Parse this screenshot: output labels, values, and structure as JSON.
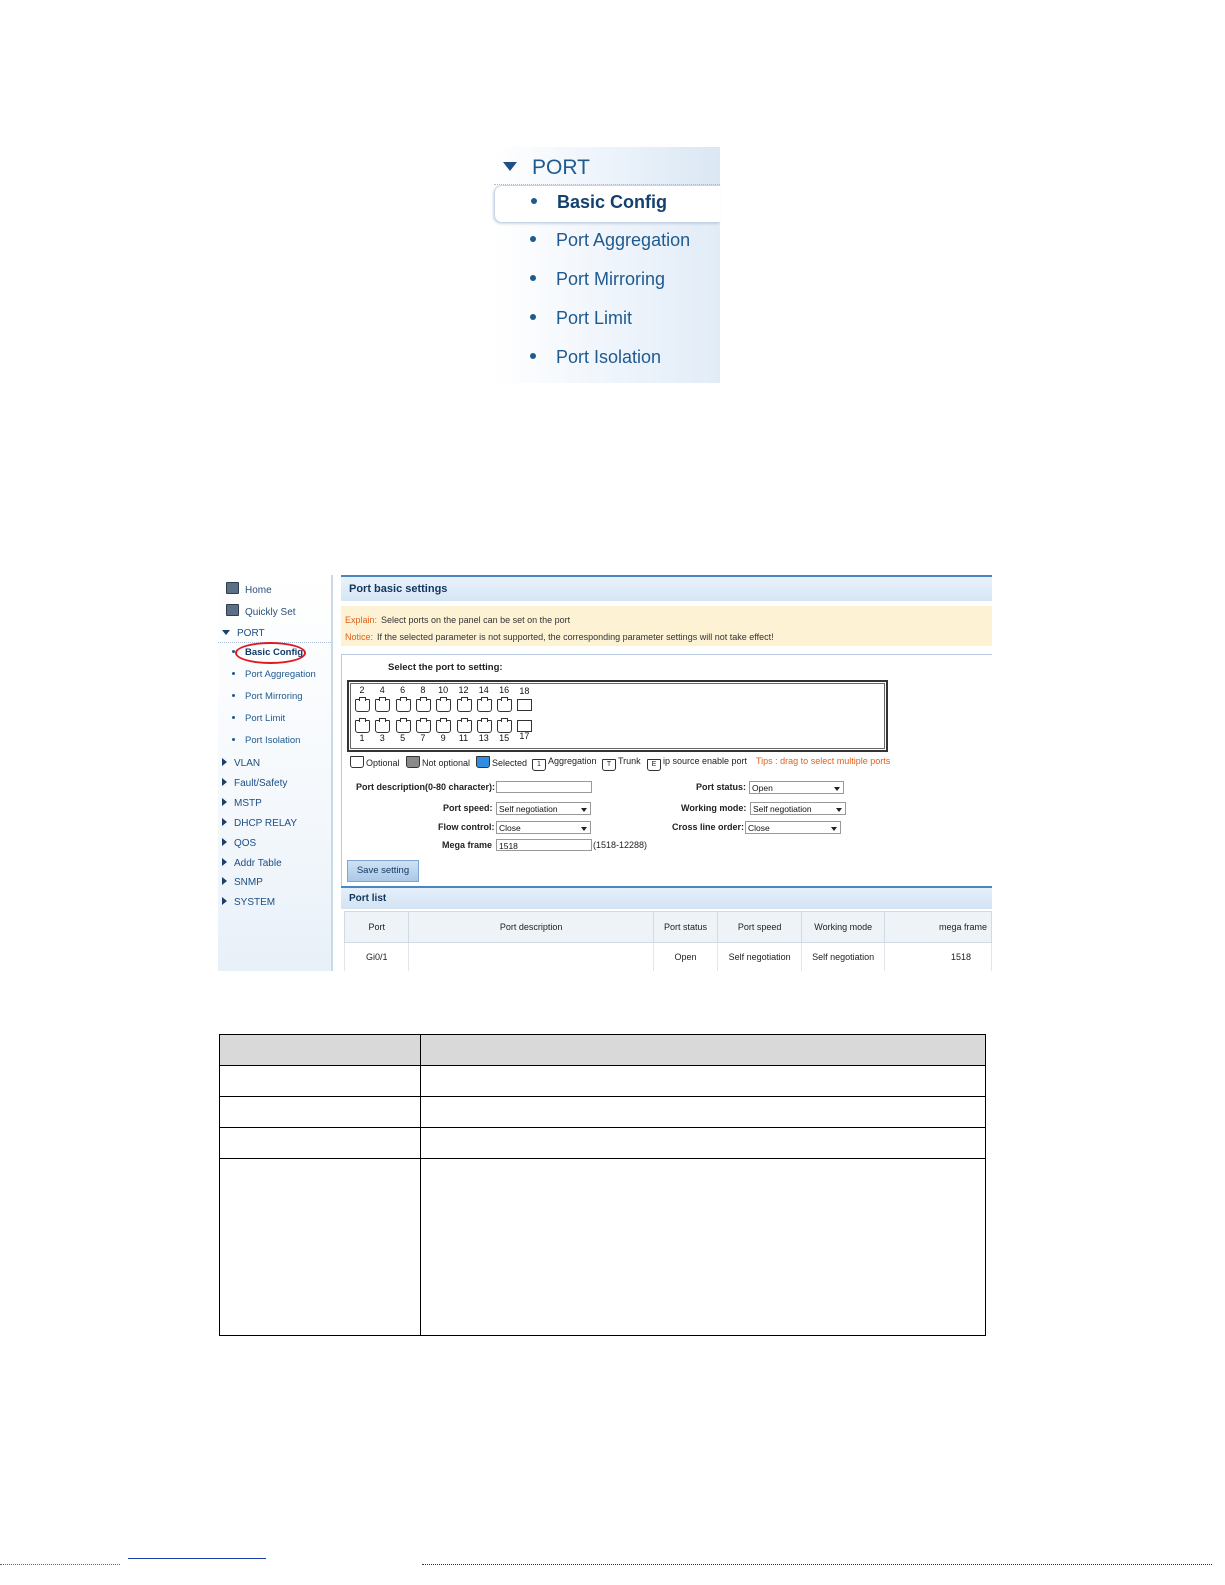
{
  "zoom_menu": {
    "title": "PORT",
    "items": [
      {
        "label": "Basic Config"
      },
      {
        "label": "Port Aggregation"
      },
      {
        "label": "Port Mirroring"
      },
      {
        "label": "Port Limit"
      },
      {
        "label": "Port Isolation"
      }
    ]
  },
  "sidebar": {
    "top": [
      {
        "label": "Home"
      },
      {
        "label": "Quickly Set"
      }
    ],
    "port_section": "PORT",
    "port_items": [
      {
        "label": "Basic Config"
      },
      {
        "label": "Port Aggregation"
      },
      {
        "label": "Port Mirroring"
      },
      {
        "label": "Port Limit"
      },
      {
        "label": "Port Isolation"
      }
    ],
    "sections": [
      {
        "label": "VLAN"
      },
      {
        "label": "Fault/Safety"
      },
      {
        "label": "MSTP"
      },
      {
        "label": "DHCP RELAY"
      },
      {
        "label": "QOS"
      },
      {
        "label": "Addr Table"
      },
      {
        "label": "SNMP"
      },
      {
        "label": "SYSTEM"
      }
    ]
  },
  "main": {
    "title": "Port basic settings",
    "explain_key": "Explain:",
    "explain_text": "Select ports on the panel can be set on the port",
    "notice_key": "Notice:",
    "notice_text": "If the selected parameter is not supported, the corresponding parameter settings will not take effect!",
    "select_label": "Select the port to setting:",
    "top_ports": [
      "2",
      "4",
      "6",
      "8",
      "10",
      "12",
      "14",
      "16",
      "18"
    ],
    "bottom_ports": [
      "1",
      "3",
      "5",
      "7",
      "9",
      "11",
      "13",
      "15",
      "17"
    ],
    "legend": {
      "optional": "Optional",
      "not_optional": "Not optional",
      "selected": "Selected",
      "aggregation": "Aggregation",
      "aggregation_mark": "1",
      "trunk": "Trunk",
      "trunk_mark": "T",
      "ip_source": "ip source enable port",
      "ip_source_mark": "E",
      "tips": "Tips : drag to select multiple ports"
    },
    "form": {
      "desc_label": "Port description(0-80 character):",
      "desc_value": "",
      "status_label": "Port status:",
      "status_value": "Open",
      "speed_label": "Port speed:",
      "speed_value": "Self negotiation",
      "mode_label": "Working mode:",
      "mode_value": "Self negotiation",
      "flow_label": "Flow control:",
      "flow_value": "Close",
      "cross_label": "Cross line order:",
      "cross_value": "Close",
      "mega_label": "Mega frame",
      "mega_value": "1518",
      "mega_hint": "(1518-12288)",
      "save_label": "Save setting"
    },
    "port_list": {
      "title": "Port list",
      "columns": [
        "Port",
        "Port description",
        "Port status",
        "Port speed",
        "Working mode",
        "mega frame"
      ],
      "rows": [
        [
          "Gi0/1",
          "",
          "Open",
          "Self negotiation",
          "Self negotiation",
          "1518"
        ]
      ]
    }
  },
  "colors": {
    "accent": "#1f5a8f",
    "highlight_circle": "#e0191f",
    "notice_bg": "#fdf2d4",
    "tips": "#e2601b"
  }
}
